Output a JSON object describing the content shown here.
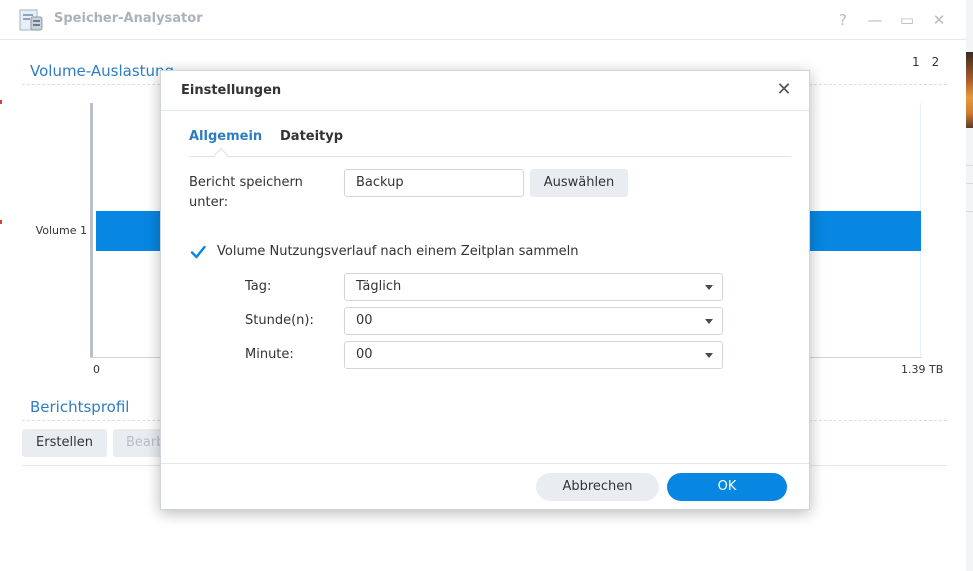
{
  "app": {
    "title": "Speicher-Analysator"
  },
  "window_controls": {
    "help": "?",
    "minimize": "—",
    "maximize": "▭",
    "close": "✕"
  },
  "pagination": [
    "1",
    "2"
  ],
  "volume_section": {
    "title": "Volume-Auslastung"
  },
  "chart_data": {
    "type": "bar",
    "orientation": "horizontal",
    "categories": [
      "Volume 1"
    ],
    "values": [
      1.39
    ],
    "xlim": [
      0,
      1.39
    ],
    "tick_labels": [
      "0",
      "1.39 TB"
    ],
    "unit": "TB",
    "bar_color": "#0786e2"
  },
  "report_section": {
    "title": "Berichtsprofil",
    "create_label": "Erstellen",
    "edit_label": "Bearb"
  },
  "dialog": {
    "title": "Einstellungen",
    "tabs": [
      {
        "label": "Allgemein",
        "active": true
      },
      {
        "label": "Dateityp",
        "active": false
      }
    ],
    "save_under_label": "Bericht speichern\nunter:",
    "save_under_value": "Backup",
    "choose_label": "Auswählen",
    "schedule_checkbox": {
      "label": "Volume Nutzungsverlauf nach einem Zeitplan sammeln",
      "checked": true
    },
    "fields": [
      {
        "label": "Tag:",
        "value": "Täglich"
      },
      {
        "label": "Stunde(n):",
        "value": "00"
      },
      {
        "label": "Minute:",
        "value": "00"
      }
    ],
    "cancel_label": "Abbrechen",
    "ok_label": "OK"
  },
  "colors": {
    "accent": "#0786e2",
    "section_title": "#2e7dc1"
  }
}
